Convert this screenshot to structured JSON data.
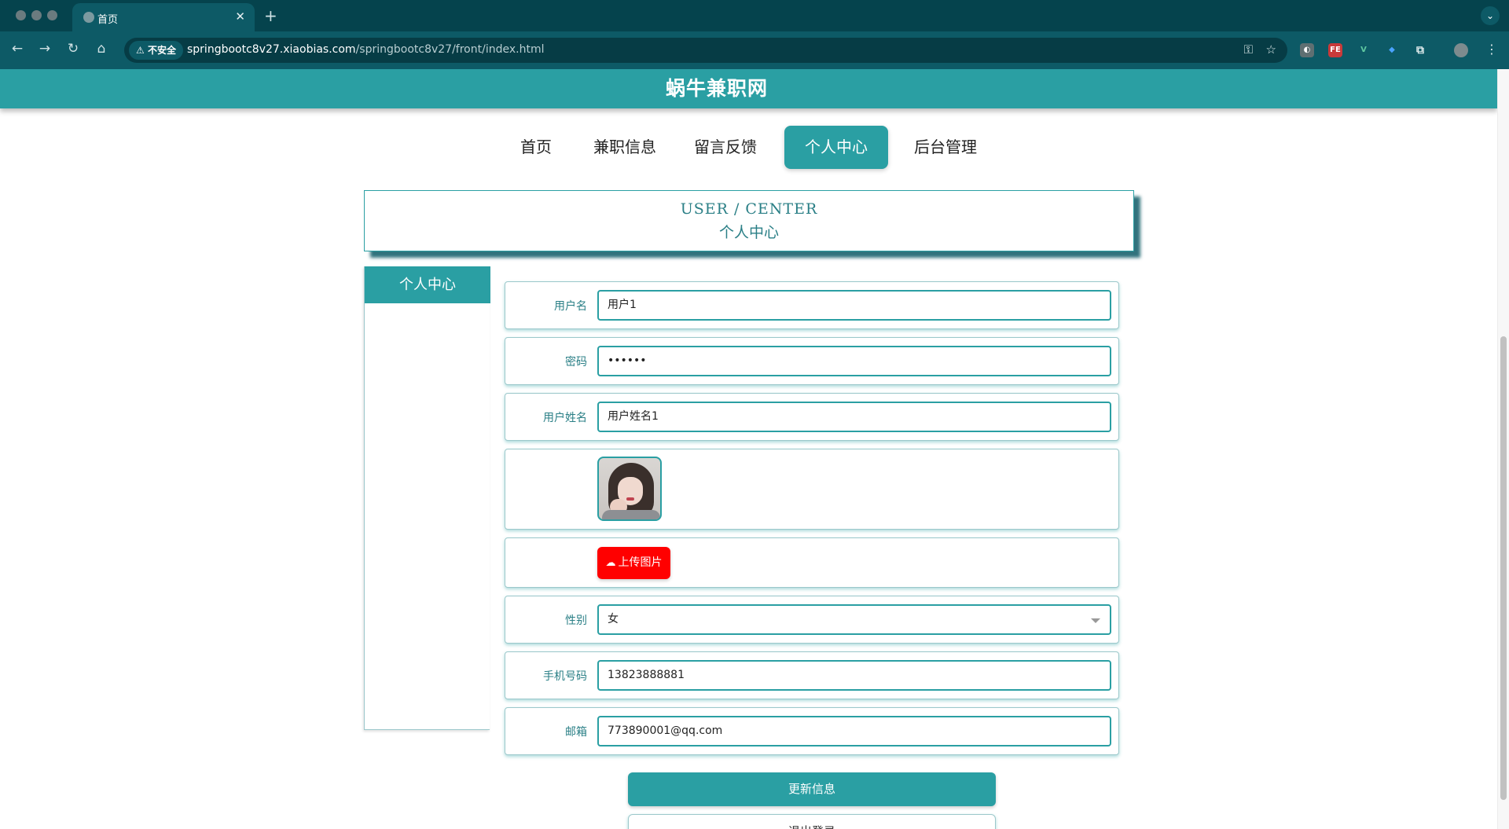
{
  "browser": {
    "tab_title": "首页",
    "tab_close": "✕",
    "new_tab": "+",
    "security_label": "不安全",
    "url_host": "springbootc8v27.xiaobias.com",
    "url_path": "/springbootc8v27/front/index.html",
    "ext_fe": "FE",
    "ext_v": "V"
  },
  "site": {
    "title": "蜗牛兼职网"
  },
  "nav": {
    "items": [
      "首页",
      "兼职信息",
      "留言反馈",
      "个人中心",
      "后台管理"
    ],
    "active": "个人中心"
  },
  "hero": {
    "en": "USER / CENTER",
    "cn": "个人中心"
  },
  "sidebar": {
    "heading": "个人中心"
  },
  "form": {
    "username_label": "用户名",
    "username_value": "用户1",
    "password_label": "密码",
    "password_value": "••••••",
    "realname_label": "用户姓名",
    "realname_value": "用户姓名1",
    "upload_label": "上传图片",
    "gender_label": "性别",
    "gender_value": "女",
    "phone_label": "手机号码",
    "phone_value": "13823888881",
    "email_label": "邮箱",
    "email_value": "773890001@qq.com"
  },
  "actions": {
    "update": "更新信息",
    "logout": "退出登录"
  },
  "colors": {
    "primary": "#2a9fa3",
    "chrome_dark": "#05434d",
    "upload_red": "#ff0000"
  }
}
